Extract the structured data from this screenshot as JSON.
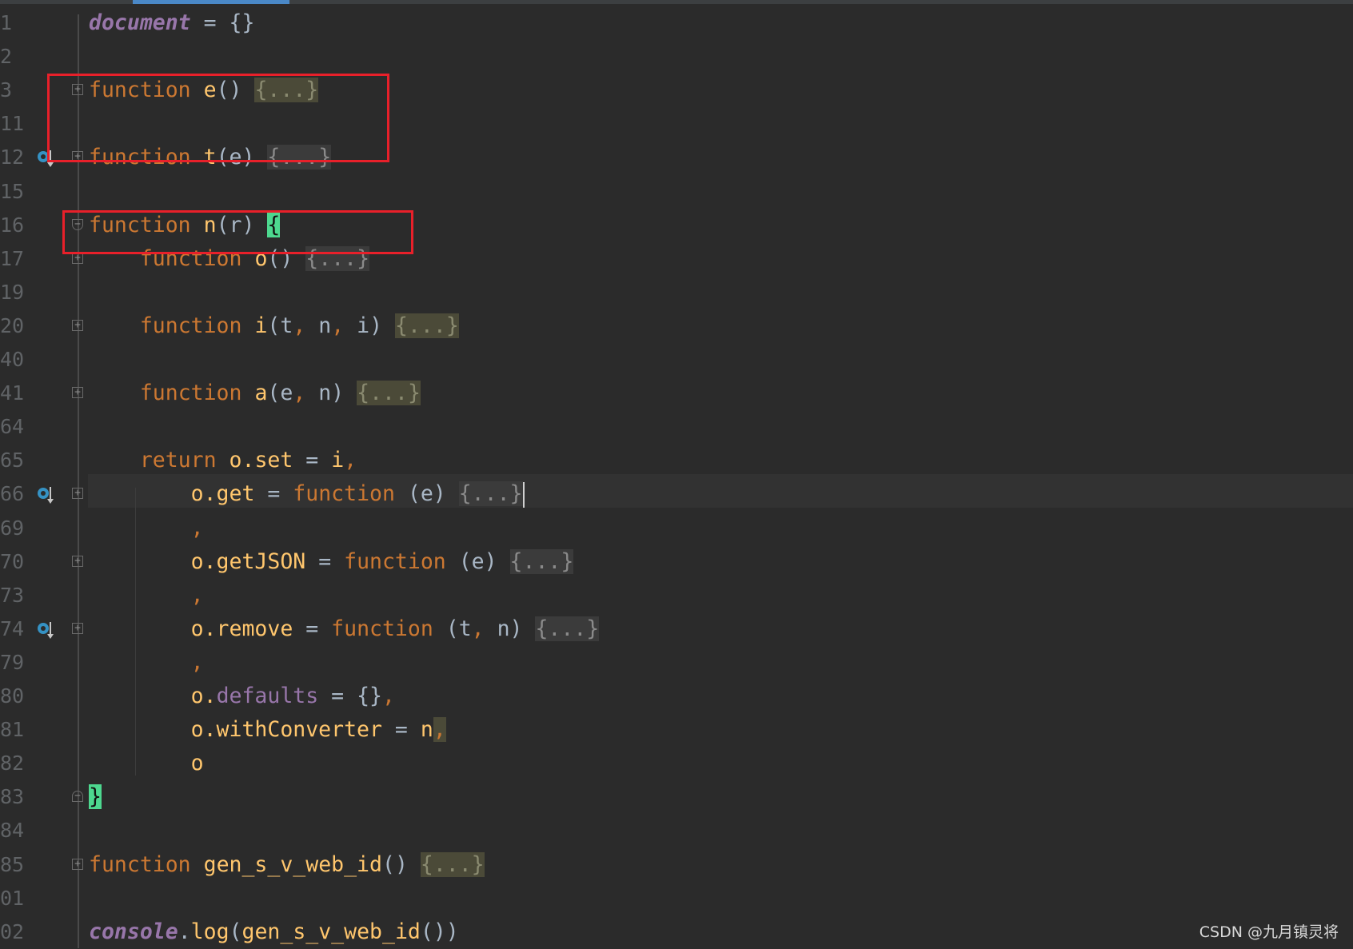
{
  "editor": {
    "colors": {
      "background": "#2b2b2b",
      "keyword": "#cc7832",
      "function": "#ffc66d",
      "purple": "#9876aa",
      "text": "#a9b7c6",
      "bracket_match": "#4dd88f",
      "annotation_box": "#e8202a"
    },
    "current_line": "66",
    "lines": [
      {
        "n": "1",
        "t": [
          [
            "document",
            "pi"
          ],
          [
            " = ",
            "op"
          ],
          [
            "{}",
            "op"
          ]
        ]
      },
      {
        "n": "2",
        "t": []
      },
      {
        "n": "3",
        "fold": "plus",
        "t": [
          [
            "function",
            "kw"
          ],
          [
            " ",
            "op"
          ],
          [
            "e",
            "fn"
          ],
          [
            "() ",
            "op"
          ],
          [
            "{...}",
            "fold1"
          ]
        ]
      },
      {
        "n": "11",
        "t": []
      },
      {
        "n": "12",
        "fold": "plus",
        "icon": "overridden-method-icon",
        "t": [
          [
            "function",
            "kw"
          ],
          [
            " ",
            "op"
          ],
          [
            "t",
            "fn"
          ],
          [
            "(e) ",
            "op"
          ],
          [
            "{...}",
            "fold"
          ]
        ]
      },
      {
        "n": "15",
        "t": []
      },
      {
        "n": "16",
        "fold": "minus",
        "t": [
          [
            "function",
            "kw"
          ],
          [
            " ",
            "op"
          ],
          [
            "n",
            "fn"
          ],
          [
            "(r) ",
            "op"
          ],
          [
            "{",
            "br"
          ]
        ]
      },
      {
        "n": "17",
        "fold": "plus",
        "t": [
          [
            "    ",
            "op"
          ],
          [
            "function",
            "kw"
          ],
          [
            " ",
            "op"
          ],
          [
            "o",
            "fn"
          ],
          [
            "() ",
            "op"
          ],
          [
            "{...}",
            "fold"
          ]
        ]
      },
      {
        "n": "19",
        "t": []
      },
      {
        "n": "20",
        "fold": "plus",
        "t": [
          [
            "    ",
            "op"
          ],
          [
            "function",
            "kw"
          ],
          [
            " ",
            "op"
          ],
          [
            "i",
            "fn"
          ],
          [
            "(t",
            "op"
          ],
          [
            ",",
            "cm"
          ],
          [
            " n",
            "op"
          ],
          [
            ",",
            "cm"
          ],
          [
            " i) ",
            "op"
          ],
          [
            "{...}",
            "fold1"
          ]
        ]
      },
      {
        "n": "40",
        "t": []
      },
      {
        "n": "41",
        "fold": "plus",
        "t": [
          [
            "    ",
            "op"
          ],
          [
            "function",
            "kw"
          ],
          [
            " ",
            "op"
          ],
          [
            "a",
            "fn"
          ],
          [
            "(e",
            "op"
          ],
          [
            ",",
            "cm"
          ],
          [
            " n) ",
            "op"
          ],
          [
            "{...}",
            "fold1"
          ]
        ]
      },
      {
        "n": "64",
        "t": []
      },
      {
        "n": "65",
        "t": [
          [
            "    ",
            "op"
          ],
          [
            "return",
            "kw"
          ],
          [
            " ",
            "op"
          ],
          [
            "o.set",
            "fn"
          ],
          [
            " = ",
            "op"
          ],
          [
            "i",
            "fn"
          ],
          [
            ",",
            "cm"
          ]
        ]
      },
      {
        "n": "66",
        "fold": "plus",
        "icon": "overridden-method-icon",
        "cursor": true,
        "t": [
          [
            "        ",
            "op"
          ],
          [
            "o.get",
            "fn"
          ],
          [
            " = ",
            "op"
          ],
          [
            "function",
            "kw"
          ],
          [
            " (e) ",
            "op"
          ],
          [
            "{...}",
            "fold"
          ]
        ]
      },
      {
        "n": "69",
        "t": [
          [
            "        ",
            "op"
          ],
          [
            ",",
            "cm"
          ]
        ]
      },
      {
        "n": "70",
        "fold": "plus",
        "t": [
          [
            "        ",
            "op"
          ],
          [
            "o.getJSON",
            "fn"
          ],
          [
            " = ",
            "op"
          ],
          [
            "function",
            "kw"
          ],
          [
            " (e) ",
            "op"
          ],
          [
            "{...}",
            "fold"
          ]
        ]
      },
      {
        "n": "73",
        "t": [
          [
            "        ",
            "op"
          ],
          [
            ",",
            "cm"
          ]
        ]
      },
      {
        "n": "74",
        "fold": "plus",
        "icon": "overridden-method-icon",
        "t": [
          [
            "        ",
            "op"
          ],
          [
            "o.remove",
            "fn"
          ],
          [
            " = ",
            "op"
          ],
          [
            "function",
            "kw"
          ],
          [
            " (t",
            "op"
          ],
          [
            ",",
            "cm"
          ],
          [
            " n) ",
            "op"
          ],
          [
            "{...}",
            "fold"
          ]
        ]
      },
      {
        "n": "79",
        "t": [
          [
            "        ",
            "op"
          ],
          [
            ",",
            "cm"
          ]
        ]
      },
      {
        "n": "80",
        "t": [
          [
            "        ",
            "op"
          ],
          [
            "o.",
            "fn"
          ],
          [
            "defaults",
            "pu"
          ],
          [
            " = {}",
            "op"
          ],
          [
            ",",
            "cm"
          ]
        ]
      },
      {
        "n": "81",
        "t": [
          [
            "        ",
            "op"
          ],
          [
            "o.withConverter",
            "fn"
          ],
          [
            " = ",
            "op"
          ],
          [
            "n",
            "fn"
          ],
          [
            ",",
            "cm hl"
          ]
        ]
      },
      {
        "n": "82",
        "t": [
          [
            "        ",
            "op"
          ],
          [
            "o",
            "fn"
          ]
        ]
      },
      {
        "n": "83",
        "fold": "end",
        "t": [
          [
            "}",
            "br"
          ]
        ]
      },
      {
        "n": "84",
        "t": []
      },
      {
        "n": "85",
        "fold": "plus",
        "t": [
          [
            "function",
            "kw"
          ],
          [
            " ",
            "op"
          ],
          [
            "gen_s_v_web_id",
            "fn"
          ],
          [
            "() ",
            "op"
          ],
          [
            "{...}",
            "fold1"
          ]
        ]
      },
      {
        "n": "01",
        "t": []
      },
      {
        "n": "02",
        "t": [
          [
            "console",
            "pi"
          ],
          [
            ".",
            "op"
          ],
          [
            "log",
            "fn"
          ],
          [
            "(",
            "op"
          ],
          [
            "gen_s_v_web_id",
            "fn"
          ],
          [
            "())",
            "op"
          ]
        ]
      }
    ]
  },
  "watermark": "CSDN @九月镇灵将"
}
